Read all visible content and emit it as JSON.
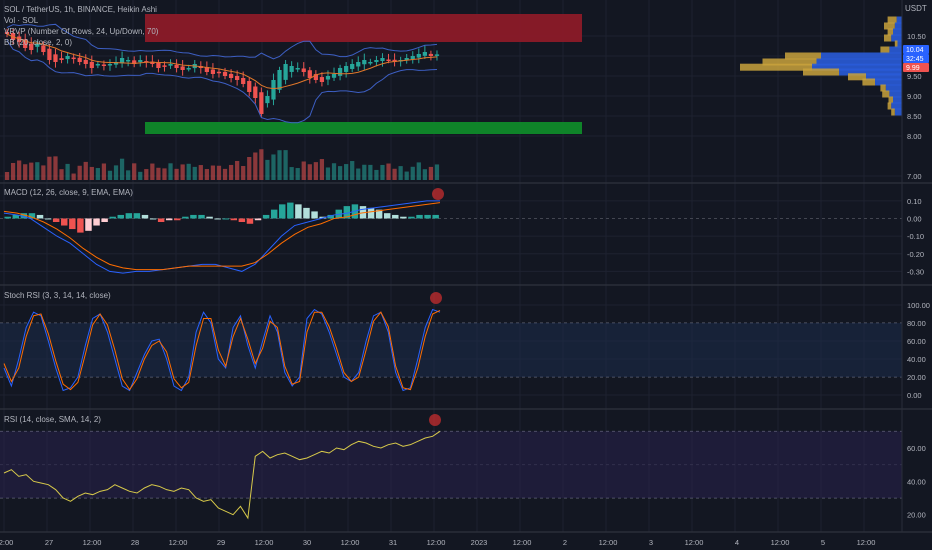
{
  "header": {
    "symbol_line": "SOL / TetherUS, 1h, BINANCE, Heikin Ashi",
    "indicators": [
      "Vol · SOL",
      "VRVP (Number Of Rows, 24, Up/Down, 70)",
      "BB (20, close, 2, 0)"
    ],
    "currency": "USDT"
  },
  "panes": {
    "macd_title": "MACD (12, 26, close, 9, EMA, EMA)",
    "stoch_title": "Stoch RSI (3, 3, 14, 14, close)",
    "rsi_title": "RSI (14, close, SMA, 14, 2)"
  },
  "price_badges": [
    "10.04",
    "32:45",
    "9.99"
  ],
  "x_axis_labels": [
    "2:00",
    "27",
    "12:00",
    "28",
    "12:00",
    "29",
    "12:00",
    "30",
    "12:00",
    "31",
    "12:00",
    "2023",
    "12:00",
    "2",
    "12:00",
    "3",
    "12:00",
    "4",
    "12:00",
    "5",
    "12:00"
  ],
  "colors": {
    "background": "#131722",
    "up": "#26a69a",
    "down": "#ef5350",
    "supply_zone": "#8b1a28",
    "demand_zone": "#0f8a2a",
    "bb_band": "#3d5fc4",
    "bb_basis": "#e0772a",
    "rsi_line": "#d7c94a",
    "vrvp_up": "#2a5bd7",
    "vrvp_down": "#c9a23c"
  },
  "chart_data": [
    {
      "type": "candlestick",
      "name": "SOL/USDT 1h Heikin Ashi",
      "ylim": [
        6.9,
        11.2
      ],
      "y_ticks": [
        7.0,
        8.0,
        8.5,
        9.0,
        9.5,
        10.0,
        10.5
      ],
      "close_series": [
        10.55,
        10.4,
        10.35,
        10.2,
        10.15,
        10.3,
        10.1,
        9.9,
        9.85,
        9.9,
        10.0,
        9.95,
        9.85,
        9.8,
        9.7,
        9.8,
        9.75,
        9.8,
        9.85,
        9.95,
        9.9,
        9.8,
        9.9,
        9.85,
        9.8,
        9.7,
        9.75,
        9.8,
        9.7,
        9.65,
        9.7,
        9.8,
        9.7,
        9.6,
        9.55,
        9.6,
        9.5,
        9.45,
        9.4,
        9.3,
        9.1,
        8.95,
        8.55,
        9.0,
        9.4,
        9.65,
        9.8,
        9.75,
        9.7,
        9.6,
        9.45,
        9.4,
        9.35,
        9.5,
        9.55,
        9.7,
        9.75,
        9.8,
        9.85,
        9.9,
        9.85,
        9.9,
        9.95,
        9.9,
        9.85,
        9.9,
        9.95,
        10.0,
        10.05,
        10.1,
        10.0,
        10.04
      ],
      "zones": [
        {
          "label": "supply",
          "from": 10.35,
          "to": 11.05
        },
        {
          "label": "demand",
          "from": 8.05,
          "to": 8.35
        }
      ],
      "price_scale_labels": [
        "10.50",
        "10.00",
        "9.50",
        "9.00",
        "8.50",
        "8.00",
        "7.00"
      ]
    },
    {
      "type": "bar",
      "name": "MACD histogram",
      "ylim": [
        -0.36,
        0.15
      ],
      "y_ticks": [
        0.1,
        0.0,
        -0.1,
        -0.2,
        -0.3
      ],
      "histogram": [
        0.01,
        0.02,
        0.03,
        0.03,
        0.02,
        0.0,
        -0.02,
        -0.04,
        -0.06,
        -0.08,
        -0.07,
        -0.04,
        -0.02,
        0.01,
        0.02,
        0.03,
        0.03,
        0.02,
        0.0,
        -0.02,
        -0.01,
        -0.01,
        0.01,
        0.02,
        0.02,
        0.01,
        0.0,
        0.0,
        -0.01,
        -0.02,
        -0.03,
        -0.01,
        0.02,
        0.05,
        0.08,
        0.09,
        0.08,
        0.06,
        0.04,
        0.01,
        0.02,
        0.05,
        0.07,
        0.08,
        0.07,
        0.06,
        0.05,
        0.03,
        0.02,
        0.01,
        0.01,
        0.02,
        0.02,
        0.02
      ],
      "macd_line": [
        0.03,
        0.02,
        0.0,
        -0.05,
        -0.1,
        -0.14,
        -0.2,
        -0.26,
        -0.3,
        -0.31,
        -0.3,
        -0.3,
        -0.29,
        -0.28,
        -0.27,
        -0.26,
        -0.26,
        -0.28,
        -0.3,
        -0.26,
        -0.18,
        -0.1,
        -0.04,
        -0.02,
        0.0,
        0.02,
        0.03,
        0.05,
        0.06,
        0.07,
        0.08,
        0.09,
        0.1,
        0.1
      ],
      "signal_line": [
        0.04,
        0.03,
        0.01,
        -0.02,
        -0.06,
        -0.11,
        -0.17,
        -0.22,
        -0.26,
        -0.28,
        -0.29,
        -0.29,
        -0.29,
        -0.28,
        -0.27,
        -0.27,
        -0.27,
        -0.27,
        -0.27,
        -0.25,
        -0.2,
        -0.14,
        -0.09,
        -0.05,
        -0.03,
        0.0,
        0.01,
        0.03,
        0.04,
        0.05,
        0.06,
        0.07,
        0.08,
        0.09
      ]
    },
    {
      "type": "line",
      "name": "Stoch RSI",
      "ylim": [
        -10,
        110
      ],
      "y_ticks": [
        100,
        80,
        60,
        40,
        20,
        0
      ],
      "k": [
        30,
        10,
        40,
        75,
        92,
        88,
        60,
        30,
        5,
        8,
        20,
        55,
        85,
        90,
        70,
        40,
        10,
        5,
        25,
        45,
        60,
        62,
        40,
        10,
        5,
        20,
        70,
        92,
        80,
        40,
        30,
        75,
        88,
        55,
        30,
        60,
        88,
        70,
        25,
        10,
        20,
        85,
        95,
        90,
        70,
        45,
        20,
        15,
        25,
        60,
        88,
        92,
        70,
        25,
        5,
        8,
        40,
        75,
        95,
        92
      ],
      "d": [
        35,
        15,
        30,
        65,
        88,
        90,
        68,
        38,
        12,
        6,
        14,
        45,
        78,
        90,
        78,
        50,
        18,
        6,
        18,
        40,
        55,
        60,
        48,
        18,
        8,
        14,
        55,
        85,
        85,
        50,
        32,
        65,
        85,
        62,
        35,
        52,
        82,
        75,
        32,
        12,
        15,
        70,
        92,
        92,
        76,
        52,
        25,
        15,
        20,
        50,
        82,
        92,
        76,
        32,
        8,
        6,
        30,
        65,
        90,
        94
      ]
    },
    {
      "type": "line",
      "name": "RSI",
      "ylim": [
        12,
        78
      ],
      "y_ticks": [
        60,
        40,
        20
      ],
      "values": [
        45,
        47,
        43,
        44,
        40,
        39,
        38,
        35,
        30,
        28,
        31,
        33,
        32,
        34,
        35,
        38,
        36,
        34,
        33,
        36,
        38,
        37,
        35,
        34,
        36,
        35,
        30,
        28,
        29,
        24,
        22,
        20,
        25,
        18,
        55,
        58,
        54,
        56,
        57,
        55,
        53,
        54,
        56,
        58,
        57,
        60,
        59,
        62,
        64,
        63,
        61,
        60,
        62,
        63,
        61,
        62,
        64,
        66,
        67,
        70
      ]
    }
  ]
}
